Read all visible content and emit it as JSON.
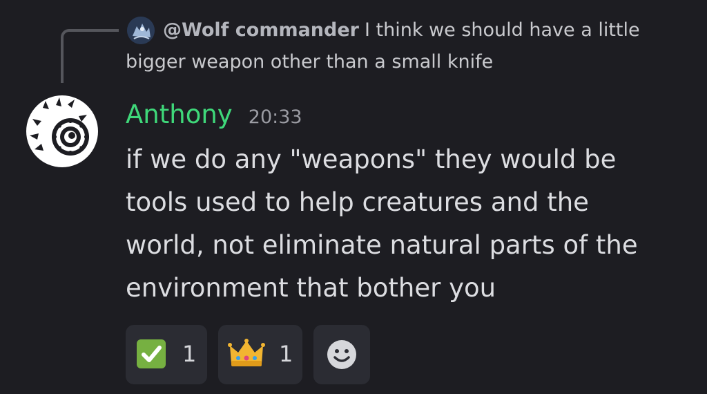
{
  "reply": {
    "author": "@Wolf commander",
    "text_line1": "I think we should have a little",
    "text_line2": "bigger weapon other than a small knife"
  },
  "message": {
    "author": "Anthony",
    "timestamp": "20:33",
    "lines": [
      "if we do any \"weapons\" they would be",
      "tools used to help creatures and the",
      "world, not eliminate natural parts of the",
      "environment that bother you"
    ]
  },
  "reactions": [
    {
      "emoji": "white-check-mark",
      "count": "1"
    },
    {
      "emoji": "crown",
      "count": "1"
    }
  ],
  "add_reaction": {
    "icon": "smiley-add-reaction-icon"
  },
  "colors": {
    "background": "#1d1d22",
    "username": "#3fd87a",
    "reaction_bg": "#2b2c33"
  }
}
